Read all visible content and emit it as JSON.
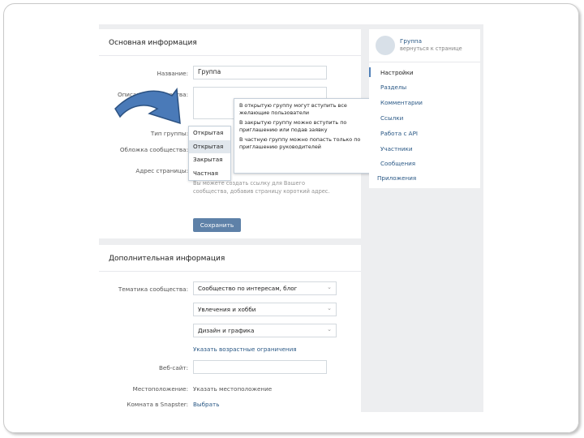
{
  "basic_info": {
    "header": "Основная информация",
    "name_label": "Название:",
    "name_value": "Группа",
    "description_label": "Описание сообщества:",
    "group_type_label": "Тип группы:",
    "group_type_value": "Открытая",
    "cover_label": "Обложка сообщества:",
    "address_label": "Адрес страницы:",
    "address_help": "Вы можете создать ссылку для Вашего сообщества, добавив страницу короткий адрес.",
    "save_label": "Сохранить"
  },
  "group_type_dropdown": {
    "options": [
      "Открытая",
      "Закрытая",
      "Частная"
    ],
    "selected": "Открытая"
  },
  "type_tooltip": {
    "lines": [
      "В открытую группу могут вступить все желающие пользователи",
      "В закрытую группу можно вступить по приглашению или подав заявку",
      "В частную группу можно попасть только по приглашению руководителей"
    ]
  },
  "extra_info": {
    "header": "Дополнительная информация",
    "topic_label": "Тематика сообщества:",
    "topic_value": "Сообщество по интересам, блог",
    "subtopic_value": "Увлечения и хобби",
    "subtopic2_value": "Дизайн и графика",
    "age_limit_link": "Указать возрастные ограничения",
    "website_label": "Веб-сайт:",
    "location_label": "Местоположение:",
    "location_link": "Указать местоположение",
    "room_label": "Комната в Snapster:",
    "room_link": "Выбрать"
  },
  "sidebar": {
    "group_name": "Группа",
    "back_link": "вернуться к странице",
    "items": [
      {
        "label": "Настройки"
      },
      {
        "label": "Разделы"
      },
      {
        "label": "Комментарии"
      },
      {
        "label": "Ссылки"
      },
      {
        "label": "Работа с API"
      },
      {
        "label": "Участники"
      },
      {
        "label": "Сообщения"
      },
      {
        "label": "Приложения"
      }
    ],
    "active_index": 0
  },
  "colors": {
    "accent": "#5e81a8",
    "link": "#2a5885",
    "arrow": "#4a7ab8"
  }
}
